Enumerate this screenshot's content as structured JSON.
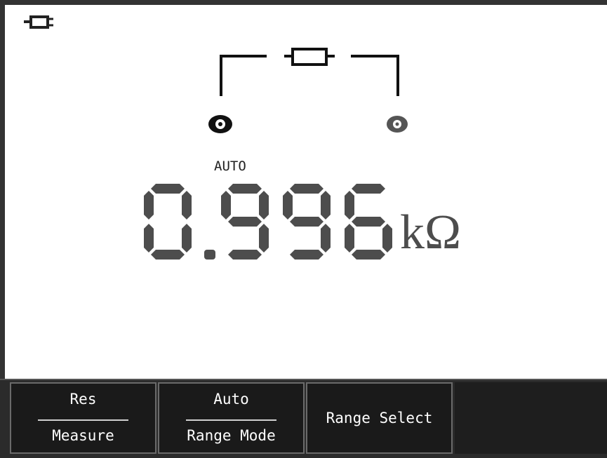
{
  "status": {
    "power_icon": "plug-icon"
  },
  "diagram": {
    "component_icon": "resistor-icon",
    "probe_left_icon": "probe-terminal-icon",
    "probe_right_icon": "probe-terminal-icon"
  },
  "display": {
    "range_mode_indicator": "AUTO",
    "reading": "0.996",
    "unit": "kΩ"
  },
  "softkeys": [
    {
      "top": "Res",
      "bottom": "Measure"
    },
    {
      "top": "Auto",
      "bottom": "Range Mode"
    },
    {
      "label": "Range Select"
    }
  ],
  "colors": {
    "frame": "#333333",
    "segment": "#4d4d4d",
    "softkey_bg": "#1a1a1a",
    "softkey_text": "#ffffff"
  }
}
